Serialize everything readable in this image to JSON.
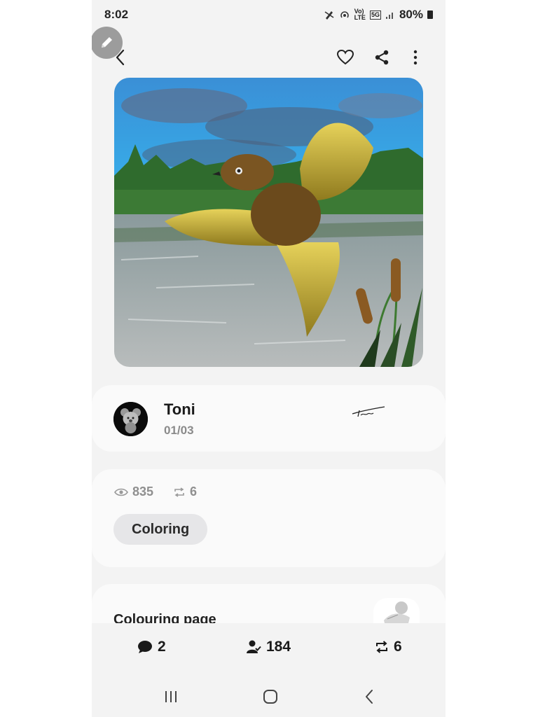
{
  "status_bar": {
    "time": "8:02",
    "network_label_top": "Vo)",
    "network_label_bottom": "LTE",
    "signal_label": "5G",
    "battery": "80%"
  },
  "artwork": {
    "description_icon": "bird-painting-image"
  },
  "author": {
    "name": "Toni",
    "date": "01/03"
  },
  "stats": {
    "views": "835",
    "reposts": "6"
  },
  "tag": "Coloring",
  "description": {
    "title": "Colouring page"
  },
  "actions": {
    "comments": "2",
    "followers": "184",
    "reposts": "6"
  },
  "colors": {
    "background": "#f3f3f3",
    "card": "#fafafa",
    "tag_bg": "#e6e6e8",
    "muted_text": "#8f8f8f"
  }
}
